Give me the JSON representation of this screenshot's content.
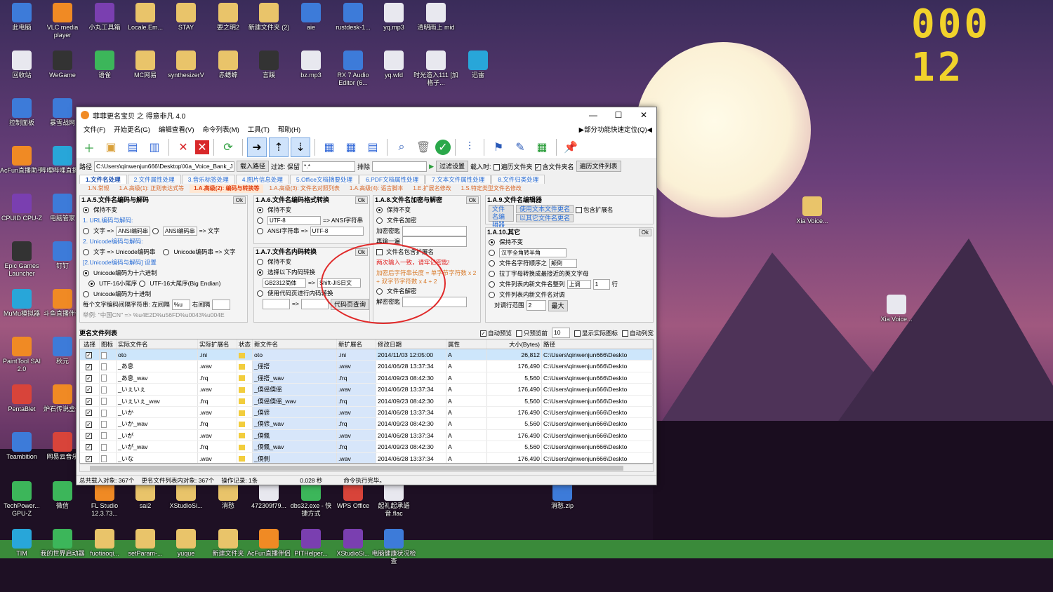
{
  "clock": {
    "value": "000 12"
  },
  "desktop_icons": [
    {
      "label": "此电脑",
      "x_col": 0
    },
    {
      "label": "VLC media player"
    },
    {
      "label": "小丸工具箱"
    },
    {
      "label": "Locale.Em..."
    },
    {
      "label": "STAY"
    },
    {
      "label": "耍之明2"
    },
    {
      "label": "新建文件夹 (2)"
    },
    {
      "label": "aie"
    },
    {
      "label": "rustdesk-1..."
    },
    {
      "label": "yq.mp3"
    },
    {
      "label": "清明雨上 mid"
    },
    {
      "label": "回收站"
    },
    {
      "label": "WeGame"
    },
    {
      "label": "语雀"
    },
    {
      "label": "MC网易"
    },
    {
      "label": "synthesizerV"
    },
    {
      "label": "赤蟋蟀"
    },
    {
      "label": "言蹊"
    },
    {
      "label": "bz.mp3"
    },
    {
      "label": "RX 7 Audio Editor (6..."
    },
    {
      "label": "yq.wfd"
    },
    {
      "label": "时光造入111 [加格子..."
    },
    {
      "label": "迅雷"
    },
    {
      "label": "控制面板"
    },
    {
      "label": "暴雪战网"
    },
    {
      "label": "AcFun直播助手"
    },
    {
      "label": "哔哩哔哩直播姬"
    },
    {
      "label": "CPUID CPU-Z"
    },
    {
      "label": "电脑管家"
    },
    {
      "label": "Epic Games Launcher"
    },
    {
      "label": "钉钉"
    },
    {
      "label": "MuMu模拟器"
    },
    {
      "label": "斗鱼直播伴侣"
    },
    {
      "label": "PaintTool SAI 2.0"
    },
    {
      "label": "秋元"
    },
    {
      "label": "PentaBlet"
    },
    {
      "label": "炉石传说盒子"
    },
    {
      "label": "Teambition"
    },
    {
      "label": "网易云音乐"
    },
    {
      "label": "TechPower... GPU-Z"
    },
    {
      "label": "微信"
    },
    {
      "label": "FL Studio 12.3.73..."
    },
    {
      "label": "sai2"
    },
    {
      "label": "XStudioSi..."
    },
    {
      "label": "消愁"
    },
    {
      "label": "472309f79..."
    },
    {
      "label": "dbs32.exe - 快捷方式"
    },
    {
      "label": "WPS Office"
    },
    {
      "label": "起礼起承語 音.flac"
    },
    {
      "label": "消愁.zip"
    },
    {
      "label": "TIM"
    },
    {
      "label": "我的世界启动器"
    },
    {
      "label": "fuotiaoqi..."
    },
    {
      "label": "setParam-..."
    },
    {
      "label": "yuque"
    },
    {
      "label": "新建文件夹"
    },
    {
      "label": "AcFun直播伴侣"
    },
    {
      "label": "PITHelper..."
    },
    {
      "label": "XStudioSi..."
    },
    {
      "label": "电脑健康状况检查"
    },
    {
      "label": "Xia Voice..."
    },
    {
      "label": "Xia Voice..."
    }
  ],
  "window": {
    "title": "菲菲更名宝贝 之 得意非凡 4.0",
    "minimize": "—",
    "maximize": "☐",
    "close": "✕",
    "menu": [
      "文件(F)",
      "开始更名(G)",
      "编辑查看(V)",
      "命令列表(M)",
      "工具(T)",
      "帮助(H)"
    ],
    "menu_right": "▶部分功能快速定位(Q)◀",
    "pathbar": {
      "path_label": "路径",
      "path_value": "C:\\Users\\qinwenjun666\\Desktop\\Xia_Voice_Bank_J",
      "load_path": "载入路径",
      "filter_label": "过滤: 保留",
      "filter_value": "*.*",
      "exclude_label": "排除",
      "filter_settings": "过滤设置",
      "load_time_label": "载入时:",
      "traverse_folders": "遍历文件夹",
      "include_folder_name": "含文件夹名",
      "traverse_list": "遍历文件列表"
    },
    "tabs": [
      "1.文件名处理",
      "2.文件属性处理",
      "3.音乐标签处理",
      "4.图片信息处理",
      "5.Office文档摘要处理",
      "6.PDF文档属性处理",
      "7.文本文件属性处理",
      "8.文件归类处理"
    ],
    "subtabs": [
      "1.N.常规",
      "1.A.高级(1): 正则表达式等",
      "1.A.高级(2): 编码与转换等",
      "1.A.高级(3): 文件名对照列表",
      "1.A.高级(4): 语言脚本",
      "1.E.扩展名修改",
      "1.S.特定类型文件名修改"
    ],
    "panel_a5": {
      "title": "1.A.5.文件名编码与解码",
      "ok": "Ok",
      "keep": "保持不变",
      "url_head": "1. URL编码与解码:",
      "url_text": "文字 =>",
      "url_sel": "ANSI编码串",
      "url_sel2": "ANSI编码串",
      "url_to_text": "=> 文字",
      "uni_head": "2. Unicode编码与解码:",
      "uni_text": "文字 => Unicode编码串",
      "uni_back": "Unicode编码串 => 文字",
      "uni_settings": "[2.Unicode编码与解码] 设置",
      "hex": "Unicode编码为十六进制",
      "utf16le": "UTF-16小尾序",
      "utf16be": "UTF-16大尾序(Big Endian)",
      "dec": "Unicode编码为十进制",
      "sep_label": "每个文字编码间隔字符串: 左间隔",
      "left_sep": "%u",
      "right_sep_label": "右间隔",
      "example": "举例: \"中国CN\" => %u4E2D%u56FD%u0043%u004E"
    },
    "panel_a6": {
      "title": "1.A.6.文件名编码格式转换",
      "ok": "Ok",
      "keep": "保持不变",
      "from": "UTF-8",
      "to_ansi": "=> ANSI字符串",
      "ansi_label": "ANSI字符串 =>",
      "ansi_to": "UTF-8"
    },
    "panel_a7": {
      "title": "1.A.7.文件名内码转换",
      "ok": "Ok",
      "keep": "保持不变",
      "select": "选择以下内码转换",
      "from": "GB2312简体",
      "arrow": "=>",
      "to": "Shift-JIS日文",
      "codepage": "使用代码页进行内码转换",
      "cp_arrow": "=>",
      "cp_query": "代码页查询"
    },
    "panel_a8": {
      "title": "1.A.8.文件名加密与解密",
      "ok": "Ok",
      "keep": "保持不变",
      "encrypt": "文件名加密",
      "pwd": "加密密匙",
      "pwd2": "再输一遍",
      "include_ext": "文件名包含扩展名",
      "warn": "两次输入一致，请牢记密匙!",
      "len_note": "加密后字符串长度 = 单字节字符数 x 2 + 双字节字符数 x 4 + 2",
      "decrypt": "文件名解密",
      "dpwd": "解密密匙"
    },
    "panel_a9": {
      "title": "1.A.9.文件名编辑器",
      "editor": "文件名编辑器",
      "use_text": "使用文本文件更名",
      "use_other": "以其它文件名更名",
      "include_ext": "包含扩展名"
    },
    "panel_a10": {
      "title": "1.A.10.其它",
      "ok": "Ok",
      "keep": "保持不变",
      "fullhalf": "汉字全角转半角",
      "order": "文件名字符顺序之",
      "order_sel": "颠倒",
      "latin": "拉丁字母转换成最接近的英文字母",
      "sort": "文件列表内新文件名整列",
      "sort_sel": "上调",
      "sort_n": "1",
      "sort_unit": "行",
      "swap": "文件列表内新文件名对调",
      "range_label": "对调行范围",
      "range_n": "2",
      "max": "最大"
    },
    "list": {
      "title": "更名文件列表",
      "auto_preview": "自动预览",
      "preview_only": "只预览前",
      "preview_n": "10",
      "show_icons": "显示实际图标",
      "auto_cols": "自动列宽",
      "columns": [
        "选择",
        "图标",
        "实际文件名",
        "实际扩展名",
        "状态",
        "新文件名",
        "新扩展名",
        "修改日期",
        "属性",
        "大小(Bytes)",
        "路径"
      ],
      "rows": [
        {
          "real": "oto",
          "rext": ".ini",
          "new": "oto",
          "next": ".ini",
          "date": "2014/11/03 12:05:00",
          "attr": "A",
          "size": "26,812",
          "path": "C:\\Users\\qinwenjun666\\Deskto"
        },
        {
          "real": "_あ息",
          "rext": ".wav",
          "new": "_傜撘",
          "next": ".wav",
          "date": "2014/06/28 13:37:34",
          "attr": "A",
          "size": "176,490",
          "path": "C:\\Users\\qinwenjun666\\Deskto"
        },
        {
          "real": "_あ息_wav",
          "rext": ".frq",
          "new": "_傜撘_wav",
          "next": ".frq",
          "date": "2014/09/23 08:42:30",
          "attr": "A",
          "size": "5,560",
          "path": "C:\\Users\\qinwenjun666\\Deskto"
        },
        {
          "real": "_いぇいぇ",
          "rext": ".wav",
          "new": "_偄傜偄傜",
          "next": ".wav",
          "date": "2014/06/28 13:37:34",
          "attr": "A",
          "size": "176,490",
          "path": "C:\\Users\\qinwenjun666\\Deskto"
        },
        {
          "real": "_いぇいぇ_wav",
          "rext": ".frq",
          "new": "_偄傜偄傜_wav",
          "next": ".frq",
          "date": "2014/09/23 08:42:30",
          "attr": "A",
          "size": "5,560",
          "path": "C:\\Users\\qinwenjun666\\Deskto"
        },
        {
          "real": "_いか",
          "rext": ".wav",
          "new": "_偄偐",
          "next": ".wav",
          "date": "2014/06/28 13:37:34",
          "attr": "A",
          "size": "176,490",
          "path": "C:\\Users\\qinwenjun666\\Deskto"
        },
        {
          "real": "_いか_wav",
          "rext": ".frq",
          "new": "_偄偐_wav",
          "next": ".frq",
          "date": "2014/09/23 08:42:30",
          "attr": "A",
          "size": "5,560",
          "path": "C:\\Users\\qinwenjun666\\Deskto"
        },
        {
          "real": "_いが",
          "rext": ".wav",
          "new": "_偄偑",
          "next": ".wav",
          "date": "2014/06/28 13:37:34",
          "attr": "A",
          "size": "176,490",
          "path": "C:\\Users\\qinwenjun666\\Deskto"
        },
        {
          "real": "_いが_wav",
          "rext": ".frq",
          "new": "_偄偑_wav",
          "next": ".frq",
          "date": "2014/09/23 08:42:30",
          "attr": "A",
          "size": "5,560",
          "path": "C:\\Users\\qinwenjun666\\Deskto"
        },
        {
          "real": "_いな",
          "rext": ".wav",
          "new": "_偄側",
          "next": ".wav",
          "date": "2014/06/28 13:37:34",
          "attr": "A",
          "size": "176,490",
          "path": "C:\\Users\\qinwenjun666\\Deskto"
        }
      ]
    },
    "status": {
      "total": "总共载入对象: 367个",
      "list_count": "更名文件列表内对象: 367个",
      "ops": "操作记录: 1条",
      "time": "0.028 秒",
      "done": "命令执行完毕。"
    }
  }
}
